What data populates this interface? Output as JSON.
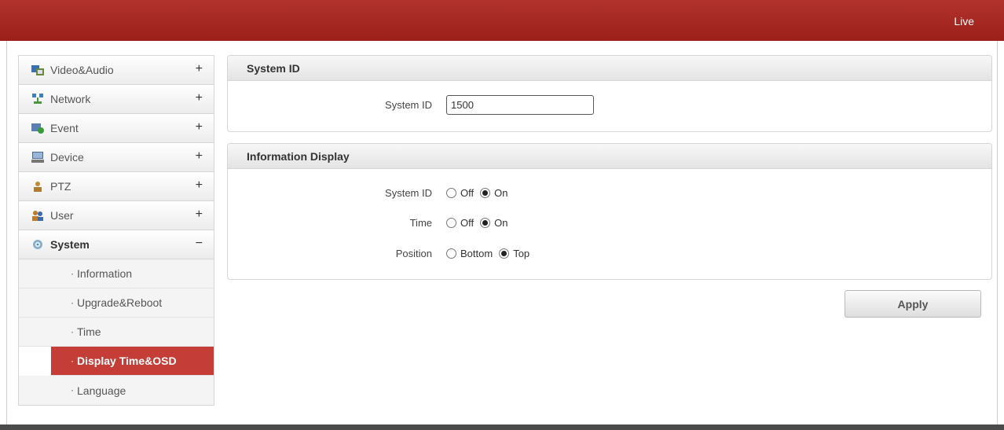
{
  "header": {
    "live_label": "Live"
  },
  "sidebar": {
    "items": [
      {
        "label": "Video&Audio",
        "toggle": "+",
        "icon": "video-audio-icon"
      },
      {
        "label": "Network",
        "toggle": "+",
        "icon": "network-icon"
      },
      {
        "label": "Event",
        "toggle": "+",
        "icon": "event-icon"
      },
      {
        "label": "Device",
        "toggle": "+",
        "icon": "device-icon"
      },
      {
        "label": "PTZ",
        "toggle": "+",
        "icon": "ptz-icon"
      },
      {
        "label": "User",
        "toggle": "+",
        "icon": "user-icon"
      },
      {
        "label": "System",
        "toggle": "−",
        "icon": "system-icon"
      }
    ],
    "sub_items": [
      {
        "label": "Information"
      },
      {
        "label": "Upgrade&Reboot"
      },
      {
        "label": "Time"
      },
      {
        "label": "Display Time&OSD",
        "active": true
      },
      {
        "label": "Language"
      }
    ],
    "bullet": "·"
  },
  "system_id_panel": {
    "title": "System ID",
    "field_label": "System ID",
    "field_value": "1500"
  },
  "info_display_panel": {
    "title": "Information Display",
    "rows": [
      {
        "label": "System ID",
        "options": [
          "Off",
          "On"
        ],
        "selected": "On"
      },
      {
        "label": "Time",
        "options": [
          "Off",
          "On"
        ],
        "selected": "On"
      },
      {
        "label": "Position",
        "options": [
          "Bottom",
          "Top"
        ],
        "selected": "Top"
      }
    ]
  },
  "actions": {
    "apply_label": "Apply"
  },
  "colors": {
    "header_red": "#a8271f",
    "active_red": "#c43d36"
  }
}
